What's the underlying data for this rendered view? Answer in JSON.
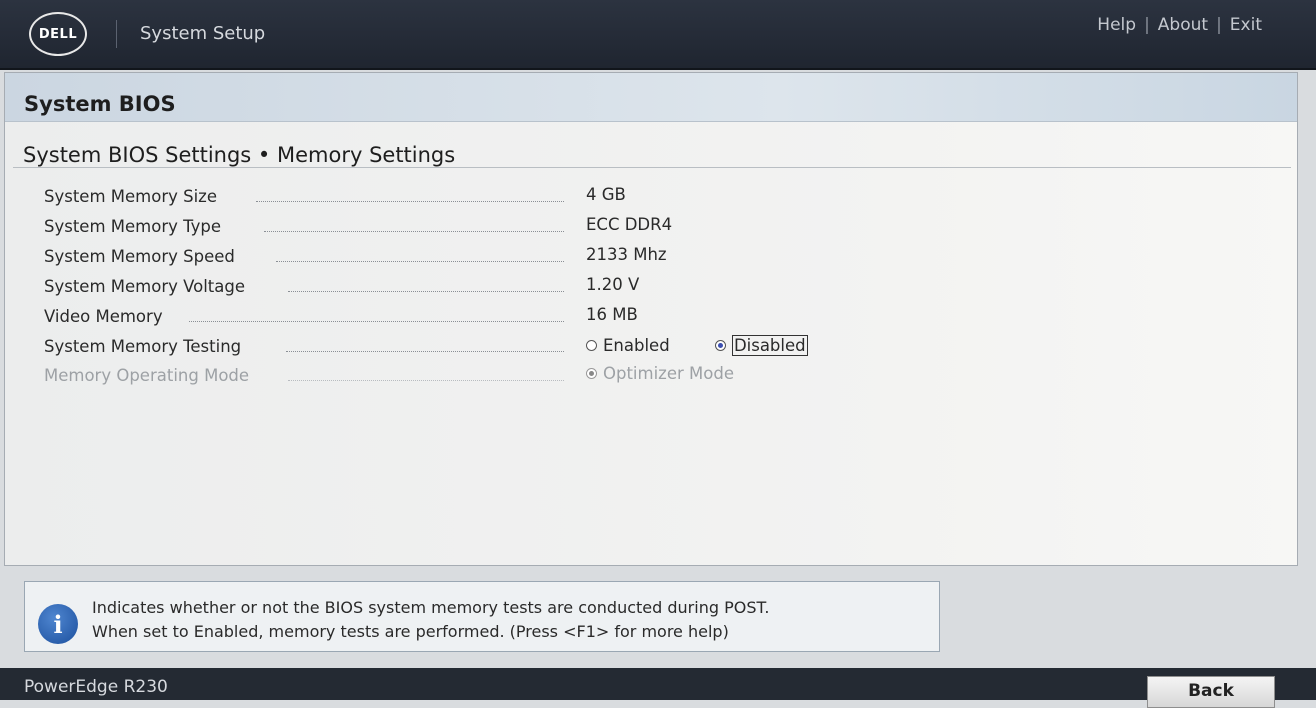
{
  "header": {
    "logo_text": "DELL",
    "app_title": "System Setup",
    "links": {
      "help": "Help",
      "about": "About",
      "exit": "Exit"
    },
    "separator": "|"
  },
  "panel": {
    "title": "System BIOS",
    "section_title": "System BIOS Settings • Memory Settings",
    "rows": [
      {
        "label": "System Memory Size",
        "value": "4 GB"
      },
      {
        "label": "System Memory Type",
        "value": "ECC DDR4"
      },
      {
        "label": "System Memory Speed",
        "value": "2133 Mhz"
      },
      {
        "label": "System Memory Voltage",
        "value": "1.20 V"
      },
      {
        "label": "Video Memory",
        "value": "16 MB"
      }
    ],
    "memory_testing": {
      "label": "System Memory Testing",
      "options": [
        "Enabled",
        "Disabled"
      ],
      "selected": "Disabled"
    },
    "operating_mode": {
      "label": "Memory Operating Mode",
      "option": "Optimizer Mode",
      "disabled": true
    }
  },
  "help": {
    "icon": "info-icon",
    "line1": "Indicates whether or not the BIOS system memory tests are conducted during POST.",
    "line2": "When set to Enabled, memory tests are performed. (Press <F1> for more help)"
  },
  "footer": {
    "model": "PowerEdge R230",
    "back_label": "Back"
  },
  "colors": {
    "topbar": "#2c3340",
    "panel_header": "#cbd6e1",
    "radio_accent": "#3c4fb0",
    "info_icon": "#1b4f9d"
  }
}
